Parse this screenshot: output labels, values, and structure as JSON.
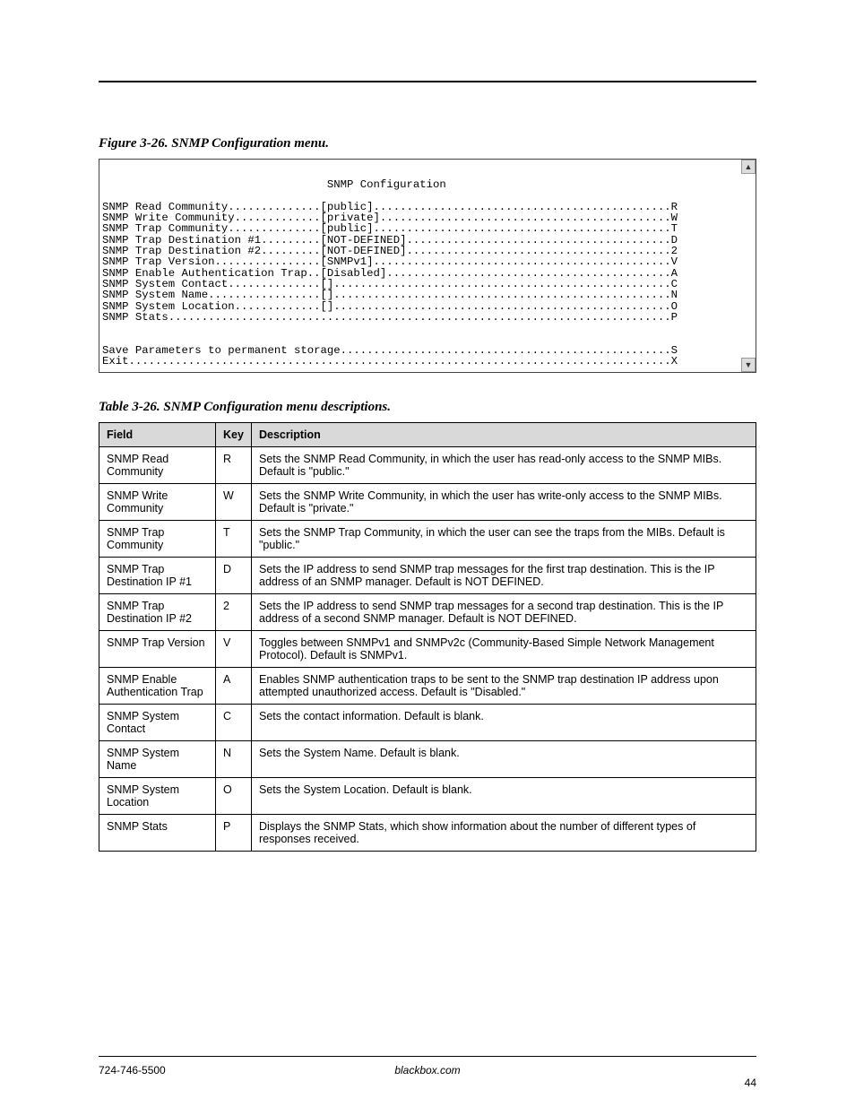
{
  "figure": {
    "caption": "Figure 3-26. SNMP Configuration menu.",
    "terminal_title": "SNMP Configuration",
    "lines": [
      {
        "label": "SNMP Read Community",
        "value": "public",
        "hotkey": "R"
      },
      {
        "label": "SNMP Write Community",
        "value": "private",
        "hotkey": "W"
      },
      {
        "label": "SNMP Trap Community",
        "value": "public",
        "hotkey": "T"
      },
      {
        "label": "SNMP Trap Destination #1",
        "value": "NOT-DEFINED",
        "hotkey": "D"
      },
      {
        "label": "SNMP Trap Destination #2",
        "value": "NOT-DEFINED",
        "hotkey": "2"
      },
      {
        "label": "SNMP Trap Version",
        "value": "SNMPv1",
        "hotkey": "V"
      },
      {
        "label": "SNMP Enable Authentication Trap",
        "value": "Disabled",
        "hotkey": "A"
      },
      {
        "label": "SNMP System Contact",
        "value": "",
        "hotkey": "C"
      },
      {
        "label": "SNMP System Name",
        "value": "",
        "hotkey": "N"
      },
      {
        "label": "SNMP System Location",
        "value": "",
        "hotkey": "O"
      },
      {
        "label": "SNMP Stats",
        "value": null,
        "hotkey": "P"
      }
    ],
    "footer_lines": [
      {
        "label": "Save Parameters to permanent storage",
        "hotkey": "S"
      },
      {
        "label": "Exit",
        "hotkey": "X"
      }
    ]
  },
  "table": {
    "caption": "Table 3-26. SNMP Configuration menu descriptions.",
    "headers": [
      "Field",
      "Key",
      "Description"
    ],
    "rows": [
      {
        "field": "SNMP Read Community",
        "key": "R",
        "desc": "Sets the SNMP Read Community, in which the user has read-only access to the SNMP MIBs. Default is \"public.\""
      },
      {
        "field": "SNMP Write Community",
        "key": "W",
        "desc": "Sets the SNMP Write Community, in which the user has write-only access to the SNMP MIBs. Default is \"private.\""
      },
      {
        "field": "SNMP Trap Community",
        "key": "T",
        "desc": "Sets the SNMP Trap Community, in which the user can see the traps from the MIBs. Default is \"public.\""
      },
      {
        "field": "SNMP Trap Destination IP #1",
        "key": "D",
        "desc": "Sets the IP address to send SNMP trap messages for the first trap destination. This is the IP address of an SNMP manager. Default is NOT DEFINED."
      },
      {
        "field": "SNMP Trap Destination IP #2",
        "key": "2",
        "desc": "Sets the IP address to send SNMP trap messages for a second trap destination. This is the IP address of a second SNMP manager. Default is NOT DEFINED."
      },
      {
        "field": "SNMP Trap Version",
        "key": "V",
        "desc": "Toggles between SNMPv1 and SNMPv2c (Community-Based Simple Network Management Protocol). Default is SNMPv1."
      },
      {
        "field": "SNMP Enable Authentication Trap",
        "key": "A",
        "desc": "Enables SNMP authentication traps to be sent to the SNMP trap destination IP address upon attempted unauthorized access. Default is \"Disabled.\""
      },
      {
        "field": "SNMP System Contact",
        "key": "C",
        "desc": "Sets the contact information. Default is blank."
      },
      {
        "field": "SNMP System Name",
        "key": "N",
        "desc": "Sets the System Name. Default is blank."
      },
      {
        "field": "SNMP System Location",
        "key": "O",
        "desc": "Sets the System Location. Default is blank."
      },
      {
        "field": "SNMP Stats",
        "key": "P",
        "desc": "Displays the SNMP Stats, which show information about the number of different types of responses received."
      }
    ]
  },
  "footer": {
    "left": "724-746-5500",
    "center": "blackbox.com",
    "right": "44"
  }
}
